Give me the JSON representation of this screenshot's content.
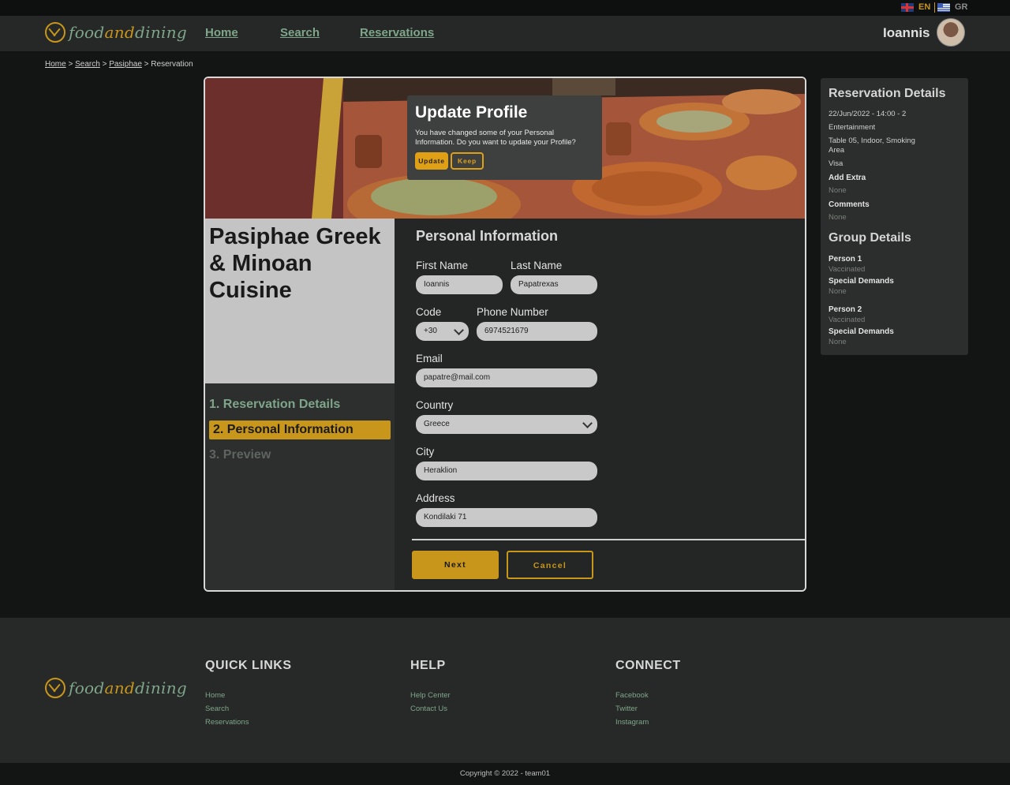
{
  "languages": [
    {
      "code": "EN",
      "flag": "uk-flag-icon",
      "active": true
    },
    {
      "code": "GR",
      "flag": "greece-flag-icon",
      "active": false
    }
  ],
  "brand": {
    "part1": "food",
    "part2": "and",
    "part3": "dining"
  },
  "nav": {
    "home": "Home",
    "search": "Search",
    "reservations": "Reservations"
  },
  "user": {
    "name": "Ioannis"
  },
  "breadcrumb": {
    "home": "Home",
    "search": "Search",
    "restaurant": "Pasiphae",
    "current": "Reservation",
    "separator": ">"
  },
  "popup": {
    "title": "Update Profile",
    "text": "You have changed some of your Personal Information. Do you want to update your Profile?",
    "update_label": "Update",
    "keep_label": "Keep"
  },
  "restaurant": {
    "name": "Pasiphae Greek & Minoan Cuisine"
  },
  "steps": {
    "step1": "1. Reservation Details",
    "step2": "2. Personal Information",
    "step3": "3. Preview"
  },
  "form": {
    "title": "Personal Information",
    "first_name": {
      "label": "First Name",
      "value": "Ioannis"
    },
    "last_name": {
      "label": "Last Name",
      "value": "Papatrexas"
    },
    "code": {
      "label": "Code",
      "value": "+30"
    },
    "phone": {
      "label": "Phone Number",
      "value": "6974521679"
    },
    "email": {
      "label": "Email",
      "value": "papatre@mail.com"
    },
    "country": {
      "label": "Country",
      "value": "Greece"
    },
    "city": {
      "label": "City",
      "value": "Heraklion"
    },
    "address": {
      "label": "Address",
      "value": "Kondilaki 71"
    },
    "next_label": "Next",
    "cancel_label": "Cancel"
  },
  "reservation_details": {
    "heading": "Reservation Details",
    "datetime": "22/Jun/2022 - 14:00 - 2",
    "type": "Entertainment",
    "table": "Table 05, Indoor, Smoking Area",
    "payment": "Visa",
    "add_extra_label": "Add Extra",
    "add_extra_value": "None",
    "comments_label": "Comments",
    "comments_value": "None"
  },
  "group_details": {
    "heading": "Group Details",
    "persons": [
      {
        "name": "Person 1",
        "status": "Vaccinated",
        "demands_label": "Special Demands",
        "demands_value": "None"
      },
      {
        "name": "Person 2",
        "status": "Vaccinated",
        "demands_label": "Special Demands",
        "demands_value": "None"
      }
    ]
  },
  "footer": {
    "quick_links": {
      "heading": "QUICK LINKS",
      "items": [
        "Home",
        "Search",
        "Reservations"
      ]
    },
    "help": {
      "heading": "HELP",
      "items": [
        "Help Center",
        "Contact Us"
      ]
    },
    "connect": {
      "heading": "CONNECT",
      "items": [
        "Facebook",
        "Twitter",
        "Instagram"
      ]
    },
    "copyright": "Copyright © 2022 - team01"
  },
  "colors": {
    "accent": "#c8961a",
    "green": "#7fa58a",
    "background": "#131514",
    "panel": "#2b2e2c"
  }
}
